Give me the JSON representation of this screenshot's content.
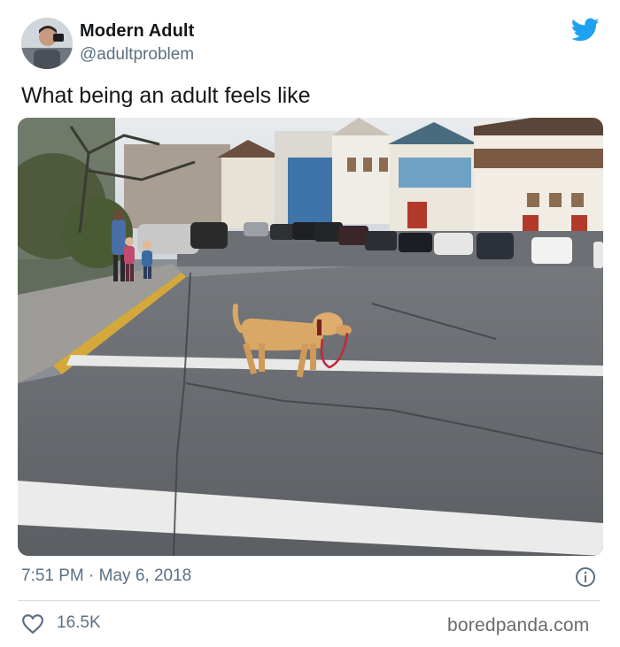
{
  "tweet": {
    "author": {
      "display_name": "Modern Adult",
      "handle": "@adultproblem",
      "avatar_icon": "user-avatar"
    },
    "platform_icon": "twitter-bird-icon",
    "text": "What being an adult feels like",
    "media": {
      "kind": "photo",
      "subject": "dog-walking-itself-on-leash"
    },
    "timestamp": "7:51 PM · May 6, 2018",
    "info_icon": "info-icon",
    "likes": {
      "icon": "heart-icon",
      "count": "16.5K"
    }
  },
  "watermark": "boredpanda.com",
  "colors": {
    "twitter_blue": "#1da1f2",
    "text_primary": "#14171a",
    "text_secondary": "#5b7083",
    "divider": "#d7dbdf"
  }
}
